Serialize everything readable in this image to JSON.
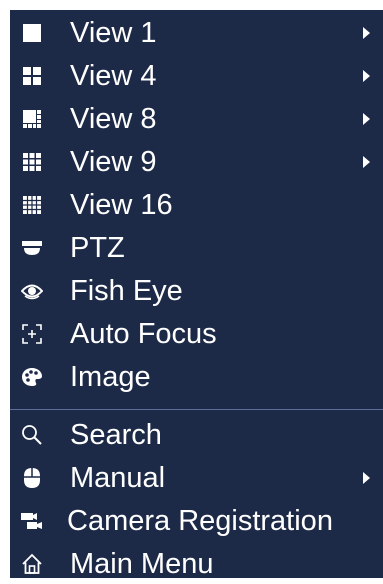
{
  "menu": {
    "items": [
      {
        "label": "View 1",
        "icon": "single-view-icon",
        "submenu": true
      },
      {
        "label": "View 4",
        "icon": "quad-view-icon",
        "submenu": true
      },
      {
        "label": "View 8",
        "icon": "eight-view-icon",
        "submenu": true
      },
      {
        "label": "View 9",
        "icon": "nine-view-icon",
        "submenu": true
      },
      {
        "label": "View 16",
        "icon": "sixteen-view-icon",
        "submenu": false
      },
      {
        "label": "PTZ",
        "icon": "ptz-camera-icon",
        "submenu": false
      },
      {
        "label": "Fish Eye",
        "icon": "fish-eye-icon",
        "submenu": false
      },
      {
        "label": "Auto Focus",
        "icon": "auto-focus-icon",
        "submenu": false
      },
      {
        "label": "Image",
        "icon": "palette-icon",
        "submenu": false
      },
      {
        "label": "Search",
        "icon": "search-icon",
        "submenu": false
      },
      {
        "label": "Manual",
        "icon": "mouse-icon",
        "submenu": true
      },
      {
        "label": "Camera Registration",
        "icon": "camera-registration-icon",
        "submenu": false
      },
      {
        "label": "Main Menu",
        "icon": "home-icon",
        "submenu": false
      }
    ]
  },
  "colors": {
    "background": "#1d2a47",
    "text": "#ffffff",
    "divider": "#5a6e97"
  }
}
